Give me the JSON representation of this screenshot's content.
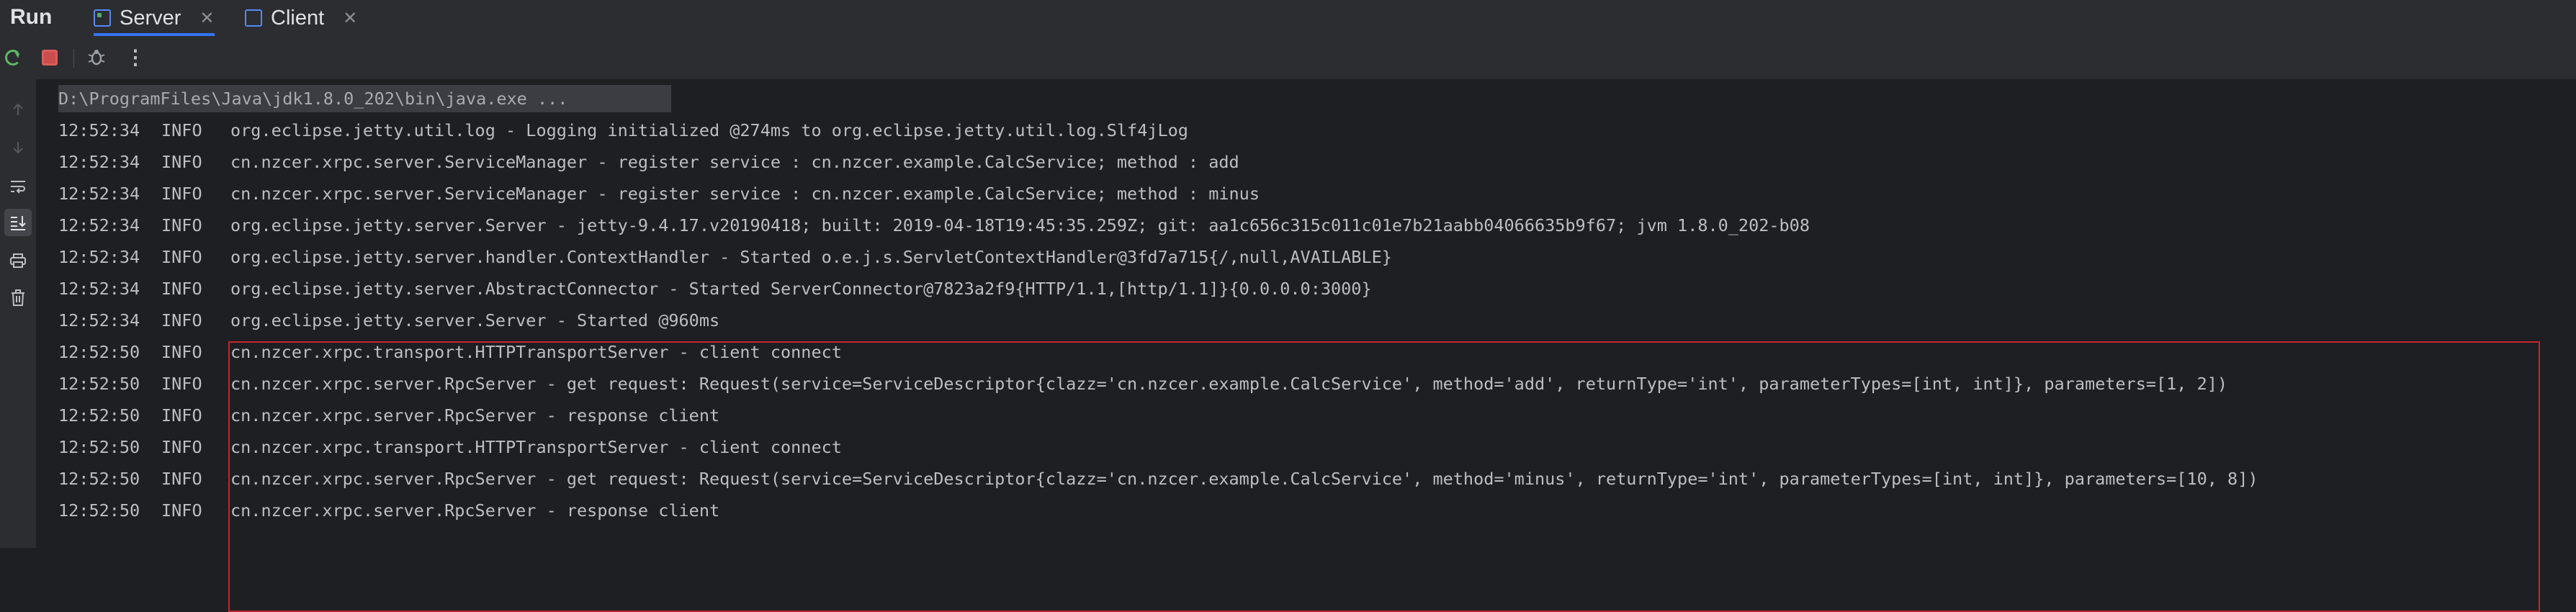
{
  "run_panel": {
    "title": "Run",
    "tabs": [
      {
        "label": "Server",
        "active": true
      },
      {
        "label": "Client",
        "active": false
      }
    ],
    "close_glyph": "✕"
  },
  "toolbar": {
    "icons": [
      "rerun-icon",
      "stop-icon",
      "debug-settings-icon",
      "more-options-icon"
    ],
    "more_glyph": "⋮"
  },
  "gutter": {
    "icons": [
      "scroll-up-icon",
      "scroll-down-icon",
      "soft-wrap-icon",
      "scroll-to-end-icon",
      "print-icon",
      "clear-all-icon"
    ]
  },
  "console": {
    "command": "D:\\ProgramFiles\\Java\\jdk1.8.0_202\\bin\\java.exe ...",
    "lines": [
      {
        "time": "12:52:34",
        "level": "INFO",
        "message": "org.eclipse.jetty.util.log - Logging initialized @274ms to org.eclipse.jetty.util.log.Slf4jLog"
      },
      {
        "time": "12:52:34",
        "level": "INFO",
        "message": "cn.nzcer.xrpc.server.ServiceManager - register service : cn.nzcer.example.CalcService; method : add"
      },
      {
        "time": "12:52:34",
        "level": "INFO",
        "message": "cn.nzcer.xrpc.server.ServiceManager - register service : cn.nzcer.example.CalcService; method : minus"
      },
      {
        "time": "12:52:34",
        "level": "INFO",
        "message": "org.eclipse.jetty.server.Server - jetty-9.4.17.v20190418; built: 2019-04-18T19:45:35.259Z; git: aa1c656c315c011c01e7b21aabb04066635b9f67; jvm 1.8.0_202-b08"
      },
      {
        "time": "12:52:34",
        "level": "INFO",
        "message": "org.eclipse.jetty.server.handler.ContextHandler - Started o.e.j.s.ServletContextHandler@3fd7a715{/,null,AVAILABLE}"
      },
      {
        "time": "12:52:34",
        "level": "INFO",
        "message": "org.eclipse.jetty.server.AbstractConnector - Started ServerConnector@7823a2f9{HTTP/1.1,[http/1.1]}{0.0.0.0:3000}"
      },
      {
        "time": "12:52:34",
        "level": "INFO",
        "message": "org.eclipse.jetty.server.Server - Started @960ms"
      },
      {
        "time": "12:52:50",
        "level": "INFO",
        "message": "cn.nzcer.xrpc.transport.HTTPTransportServer - client connect"
      },
      {
        "time": "12:52:50",
        "level": "INFO",
        "message": "cn.nzcer.xrpc.server.RpcServer - get request: Request(service=ServiceDescriptor{clazz='cn.nzcer.example.CalcService', method='add', returnType='int', parameterTypes=[int, int]}, parameters=[1, 2])"
      },
      {
        "time": "12:52:50",
        "level": "INFO",
        "message": "cn.nzcer.xrpc.server.RpcServer - response client"
      },
      {
        "time": "12:52:50",
        "level": "INFO",
        "message": "cn.nzcer.xrpc.transport.HTTPTransportServer - client connect"
      },
      {
        "time": "12:52:50",
        "level": "INFO",
        "message": "cn.nzcer.xrpc.server.RpcServer - get request: Request(service=ServiceDescriptor{clazz='cn.nzcer.example.CalcService', method='minus', returnType='int', parameterTypes=[int, int]}, parameters=[10, 8])"
      },
      {
        "time": "12:52:50",
        "level": "INFO",
        "message": "cn.nzcer.xrpc.server.RpcServer - response client"
      }
    ]
  },
  "colors": {
    "background": "#1e1f22",
    "panel": "#2b2d30",
    "text": "#bcbec4",
    "highlight_border": "#c3262c",
    "active_tab_underline": "#3574f0",
    "rerun_green": "#5fb865",
    "stop_red": "#c94f4f"
  }
}
